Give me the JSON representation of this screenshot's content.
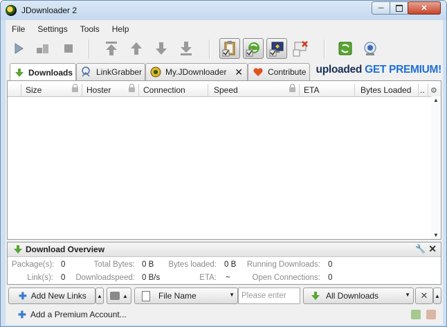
{
  "window": {
    "title": "JDownloader 2",
    "min_icon": "minimize-icon",
    "max_icon": "maximize-icon",
    "close_icon": "close-icon"
  },
  "menu": [
    "File",
    "Settings",
    "Tools",
    "Help"
  ],
  "tabs": [
    {
      "label": "Downloads",
      "icon": "download-arrow-icon",
      "active": true
    },
    {
      "label": "LinkGrabber",
      "icon": "linkgrabber-icon",
      "active": false
    },
    {
      "label": "My.JDownloader",
      "icon": "myjd-icon",
      "active": false,
      "closable": true
    },
    {
      "label": "Contribute",
      "icon": "heart-icon",
      "active": false
    }
  ],
  "banner": {
    "brand": "uploaded",
    "cta": "GET PREMIUM!"
  },
  "table": {
    "columns": [
      "Size",
      "Hoster",
      "Connection",
      "Speed",
      "ETA",
      "Bytes Loaded",
      ".."
    ],
    "rows": []
  },
  "overview": {
    "title": "Download Overview",
    "packages_label": "Package(s):",
    "packages": "0",
    "total_bytes_label": "Total Bytes:",
    "total_bytes": "0 B",
    "bytes_loaded_label": "Bytes loaded:",
    "bytes_loaded": "0 B",
    "running_label": "Running Downloads:",
    "running": "0",
    "links_label": "Link(s):",
    "links": "0",
    "speed_label": "Downloadspeed:",
    "speed": "0 B/s",
    "eta_label": "ETA:",
    "eta": "~",
    "connections_label": "Open Connections:",
    "connections": "0"
  },
  "bottombar": {
    "add_links": "Add New Links",
    "search_field": "File Name",
    "search_placeholder": "Please enter",
    "filter": "All Downloads"
  },
  "status": {
    "add_premium": "Add a Premium Account..."
  },
  "colors": {
    "accent_green": "#5aa532",
    "banner_blue": "#1f6fd6",
    "banner_dark": "#1b2f55"
  }
}
